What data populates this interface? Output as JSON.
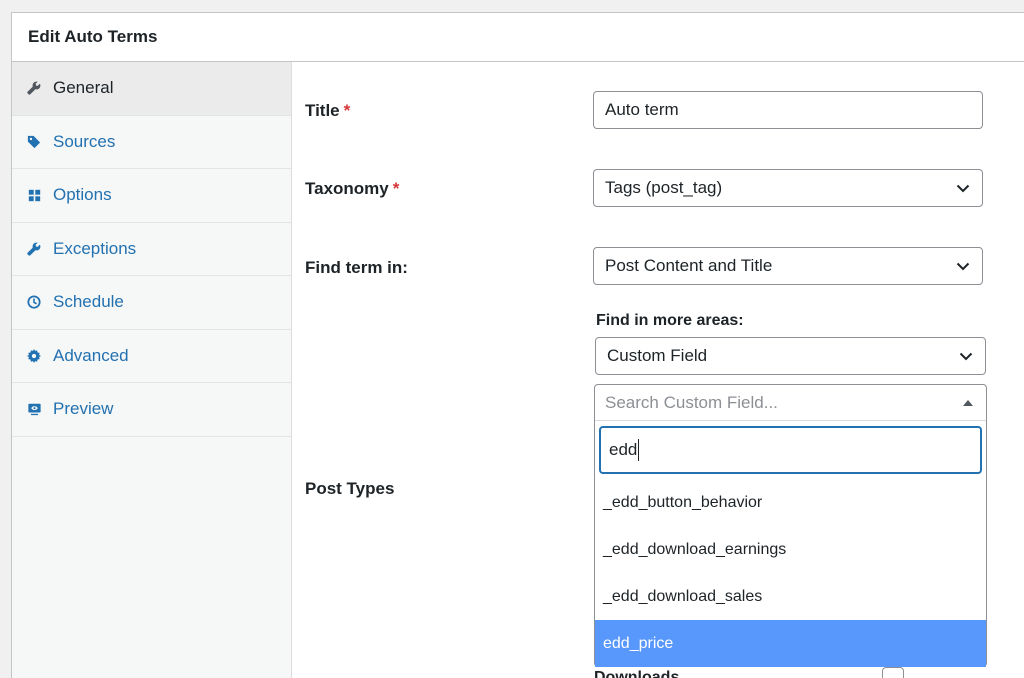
{
  "panel": {
    "title": "Edit Auto Terms"
  },
  "sidebar": {
    "items": [
      {
        "label": "General",
        "icon": "wrench-icon",
        "active": true
      },
      {
        "label": "Sources",
        "icon": "tag-icon"
      },
      {
        "label": "Options",
        "icon": "grid-icon"
      },
      {
        "label": "Exceptions",
        "icon": "wrench-icon"
      },
      {
        "label": "Schedule",
        "icon": "clock-icon"
      },
      {
        "label": "Advanced",
        "icon": "gear-icon"
      },
      {
        "label": "Preview",
        "icon": "preview-icon"
      }
    ]
  },
  "form": {
    "title_label": "Title",
    "title_value": "Auto term",
    "taxonomy_label": "Taxonomy",
    "taxonomy_value": "Tags (post_tag)",
    "find_term_label": "Find term in:",
    "find_term_value": "Post Content and Title",
    "more_areas_label": "Find in more areas:",
    "more_areas_value": "Custom Field",
    "post_types_label": "Post Types",
    "downloads_label": "Downloads",
    "required_mark": "*"
  },
  "dropdown": {
    "placeholder": "Search Custom Field...",
    "search_value": "edd",
    "options": [
      "_edd_button_behavior",
      "_edd_download_earnings",
      "_edd_download_sales",
      "edd_price"
    ],
    "highlighted_index": 3
  },
  "colors": {
    "accent": "#2271b1",
    "required": "#d63638",
    "highlight": "#5897fb"
  }
}
